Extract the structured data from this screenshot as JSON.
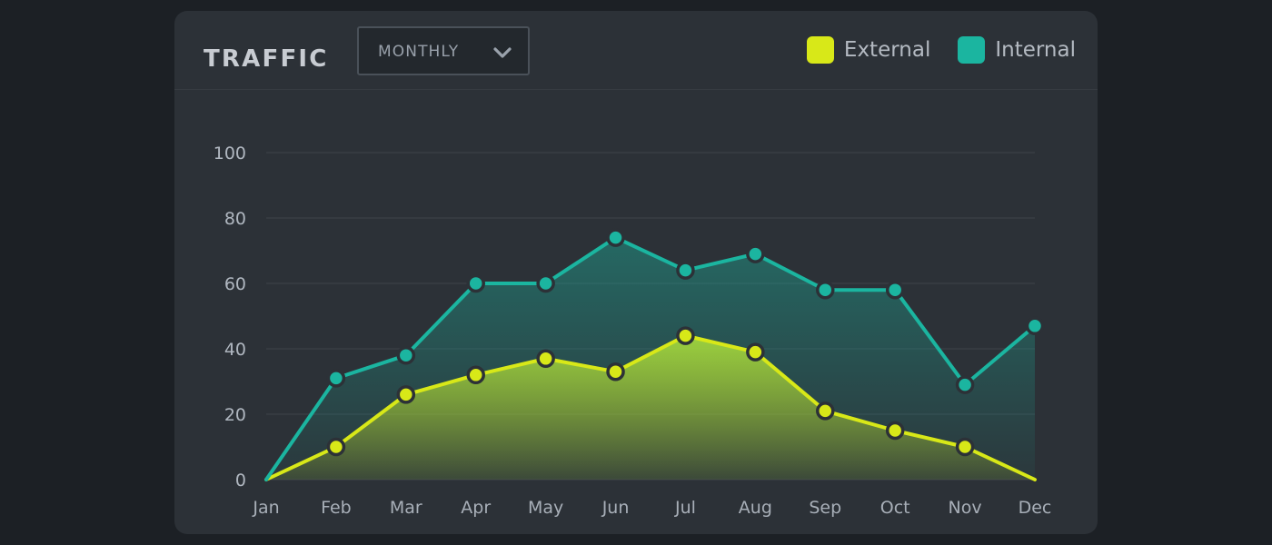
{
  "panel": {
    "title": "TRAFFIC",
    "range_select": {
      "value": "MONTHLY",
      "icon": "chevron-down-icon"
    }
  },
  "legend": {
    "position": "top-right",
    "items": [
      {
        "label": "External",
        "color": "#d8e818"
      },
      {
        "label": "Internal",
        "color": "#1bb5a0"
      }
    ]
  },
  "chart_data": {
    "type": "area",
    "title": "TRAFFIC",
    "xlabel": "",
    "ylabel": "",
    "ylim": [
      0,
      100
    ],
    "yticks": [
      0,
      20,
      40,
      60,
      80,
      100
    ],
    "grid": true,
    "legend_position": "top-right",
    "categories": [
      "Jan",
      "Feb",
      "Mar",
      "Apr",
      "May",
      "Jun",
      "Jul",
      "Aug",
      "Sep",
      "Oct",
      "Nov",
      "Dec"
    ],
    "series": [
      {
        "name": "External",
        "color": "#d8e818",
        "values": [
          0,
          10,
          26,
          32,
          37,
          33,
          44,
          39,
          21,
          15,
          10,
          0
        ]
      },
      {
        "name": "Internal",
        "color": "#1bb5a0",
        "values": [
          0,
          31,
          38,
          60,
          60,
          74,
          64,
          69,
          58,
          58,
          29,
          47
        ]
      }
    ]
  },
  "colors": {
    "page_background": "#1c2025",
    "panel_background": "#2c3137",
    "gridline": "#383d44",
    "axis_text": "#b0b7c0",
    "title_text": "#c8ccd2"
  }
}
